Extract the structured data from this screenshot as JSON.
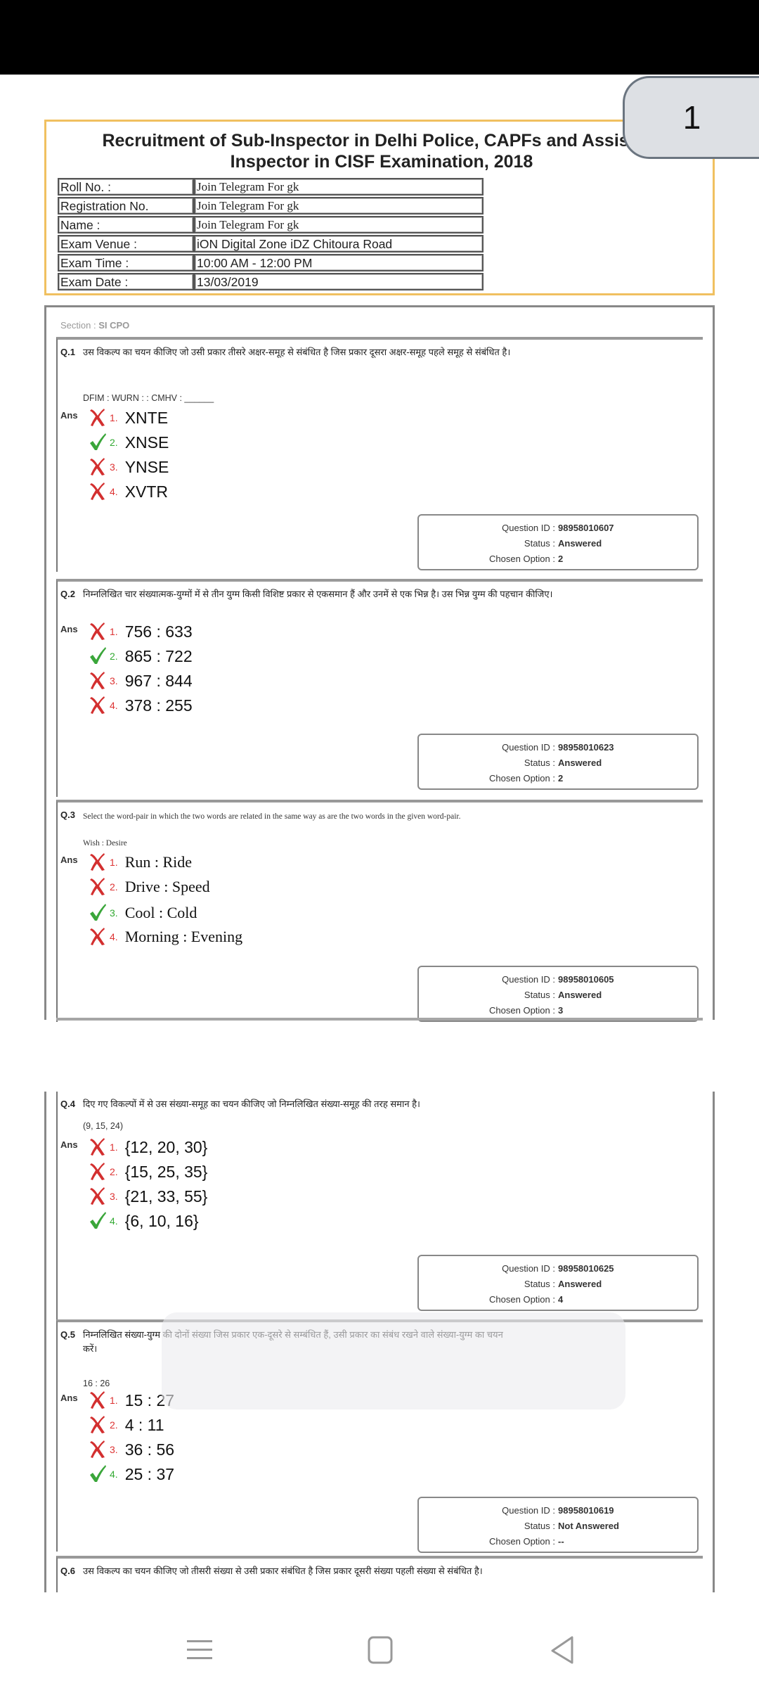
{
  "viewer": {
    "page_number": "1"
  },
  "header": {
    "title_line1": "Recruitment of Sub-Inspector in Delhi Police, CAPFs and Assistant",
    "title_line2": "Inspector in CISF Examination, 2018",
    "info": [
      {
        "label": "Roll No. :",
        "value": "Join Telegram For gk"
      },
      {
        "label": "Registration No.",
        "value": "Join Telegram For gk"
      },
      {
        "label": "Name :",
        "value": "Join Telegram For gk"
      },
      {
        "label": "Exam Venue :",
        "value": "iON Digital Zone iDZ Chitoura Road"
      },
      {
        "label": "Exam Time :",
        "value": "10:00 AM - 12:00 PM"
      },
      {
        "label": "Exam Date :",
        "value": "13/03/2019"
      }
    ]
  },
  "section": {
    "label": "Section : ",
    "name": "SI CPO"
  },
  "labels": {
    "ans": "Ans",
    "question_id": "Question ID :",
    "status": "Status :",
    "chosen_option": "Chosen Option :"
  },
  "colors": {
    "correct": "#3aa63a",
    "wrong": "#d32f2f",
    "header_border": "#f0c060"
  },
  "questions": [
    {
      "number": "Q.1",
      "text": "उस विकल्प का चयन कीजिए जो उसी प्रकार तीसरे अक्षर-समूह से संबंधित है जिस प्रकार दूसरा अक्षर-समूह पहले समूह से संबंधित है।",
      "given": "DFIM : WURN : : CMHV : ______",
      "options": [
        {
          "num": "1.",
          "text": "XNTE",
          "correct": false
        },
        {
          "num": "2.",
          "text": "XNSE",
          "correct": true
        },
        {
          "num": "3.",
          "text": "YNSE",
          "correct": false
        },
        {
          "num": "4.",
          "text": "XVTR",
          "correct": false
        }
      ],
      "question_id": "98958010607",
      "status": "Answered",
      "chosen_option": "2"
    },
    {
      "number": "Q.2",
      "text": "निम्नलिखित चार संख्यात्मक-युग्मों में से तीन युग्म किसी विशिष्ट प्रकार से एकसमान हैं और उनमें से एक भिन्न है। उस भिन्न युग्म की पहचान कीजिए।",
      "given": "",
      "options": [
        {
          "num": "1.",
          "text": "756 : 633",
          "correct": false
        },
        {
          "num": "2.",
          "text": "865 : 722",
          "correct": true
        },
        {
          "num": "3.",
          "text": "967 : 844",
          "correct": false
        },
        {
          "num": "4.",
          "text": "378 : 255",
          "correct": false
        }
      ],
      "question_id": "98958010623",
      "status": "Answered",
      "chosen_option": "2"
    },
    {
      "number": "Q.3",
      "text": "Select the word-pair in which the two words are related in the same way as are the two words in the given word-pair.",
      "given": "Wish : Desire",
      "options": [
        {
          "num": "1.",
          "text": "Run : Ride",
          "correct": false
        },
        {
          "num": "2.",
          "text": "Drive : Speed",
          "correct": false
        },
        {
          "num": "3.",
          "text": "Cool : Cold",
          "correct": true
        },
        {
          "num": "4.",
          "text": "Morning : Evening",
          "correct": false
        }
      ],
      "question_id": "98958010605",
      "status": "Answered",
      "chosen_option": "3"
    },
    {
      "number": "Q.4",
      "text": "दिए गए विकल्पों में से उस संख्या-समूह का चयन कीजिए जो निम्नलिखित संख्या-समूह की तरह समान है।",
      "given": "(9, 15, 24)",
      "options": [
        {
          "num": "1.",
          "text": "{12, 20, 30}",
          "correct": false
        },
        {
          "num": "2.",
          "text": "{15, 25, 35}",
          "correct": false
        },
        {
          "num": "3.",
          "text": "{21, 33, 55}",
          "correct": false
        },
        {
          "num": "4.",
          "text": "{6, 10, 16}",
          "correct": true
        }
      ],
      "question_id": "98958010625",
      "status": "Answered",
      "chosen_option": "4"
    },
    {
      "number": "Q.5",
      "text": "निम्नलिखित संख्या-युग्म की दोनों संख्या जिस प्रकार एक-दूसरे से सम्बंधित हैं, उसी प्रकार का संबंध रखने वाले संख्या-युग्म का चयन करें।",
      "given": "16 : 26",
      "options": [
        {
          "num": "1.",
          "text": "15 : 27",
          "correct": false
        },
        {
          "num": "2.",
          "text": "4 : 11",
          "correct": false
        },
        {
          "num": "3.",
          "text": "36 : 56",
          "correct": false
        },
        {
          "num": "4.",
          "text": "25 : 37",
          "correct": true
        }
      ],
      "question_id": "98958010619",
      "status": "Not Answered",
      "chosen_option": "--"
    },
    {
      "number": "Q.6",
      "text": "उस विकल्प का चयन कीजिए जो तीसरी संख्या से उसी प्रकार संबंधित है जिस प्रकार दूसरी संख्या पहली संख्या से संबंधित है।"
    }
  ],
  "navbar": {
    "recents": "recents-icon",
    "home": "home-icon",
    "back": "back-icon"
  }
}
